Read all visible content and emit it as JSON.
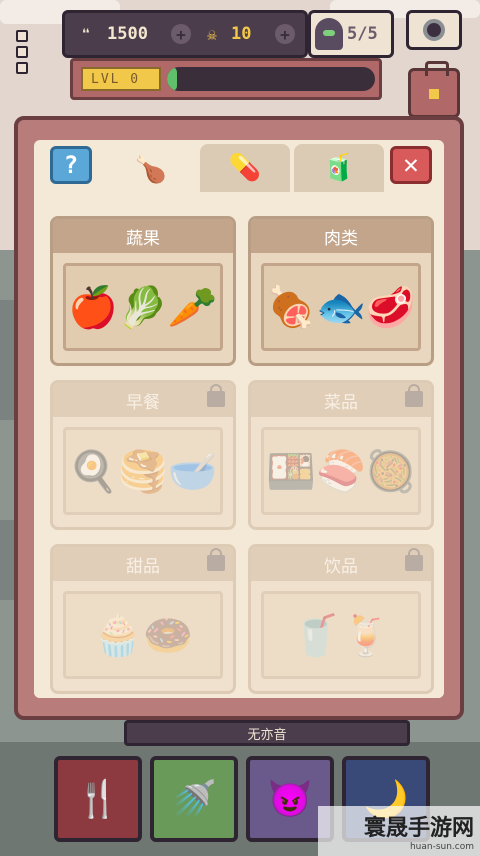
{
  "hud": {
    "coins": "1500",
    "skulls": "10",
    "ghosts": "5/5",
    "level_label": "LVL 0",
    "level_progress": 0.05
  },
  "icons": {
    "coin": "chat-bubble-icon",
    "skull": "skull-icon",
    "add": "plus-icon",
    "ghost": "ghost-icon",
    "camera": "camera-icon",
    "bag": "briefcase-icon",
    "menu": "menu-icon",
    "help": "question-icon",
    "close": "close-icon",
    "lock": "lock-icon"
  },
  "tabs": {
    "help": "?",
    "food": "🍗",
    "medicine": "💊",
    "drink": "🧃",
    "close": "✕"
  },
  "categories": [
    {
      "name": "蔬果",
      "emoji": "🍎🥬🥕",
      "locked": false
    },
    {
      "name": "肉类",
      "emoji": "🍖🐟🥩",
      "locked": false
    },
    {
      "name": "早餐",
      "emoji": "🍳🥞🥣",
      "locked": true
    },
    {
      "name": "菜品",
      "emoji": "🍱🍣🥘",
      "locked": true
    },
    {
      "name": "甜品",
      "emoji": "🧁🍩",
      "locked": true
    },
    {
      "name": "饮品",
      "emoji": "🥤🍹",
      "locked": true
    }
  ],
  "nameplate": "无亦音",
  "tools": {
    "eat": "🍴",
    "wash": "🚿",
    "mood": "😈",
    "sleep": "🌙"
  },
  "watermark": {
    "title": "寰晟手游网",
    "url": "huan-sun.com"
  },
  "colors": {
    "panel": "#b87d7a",
    "panel_inner": "#f4e8d6",
    "accent_yellow": "#f2c84b",
    "help_blue": "#5aa7d8",
    "close_red": "#d85a5a",
    "progress_green": "#5fbf6a"
  }
}
